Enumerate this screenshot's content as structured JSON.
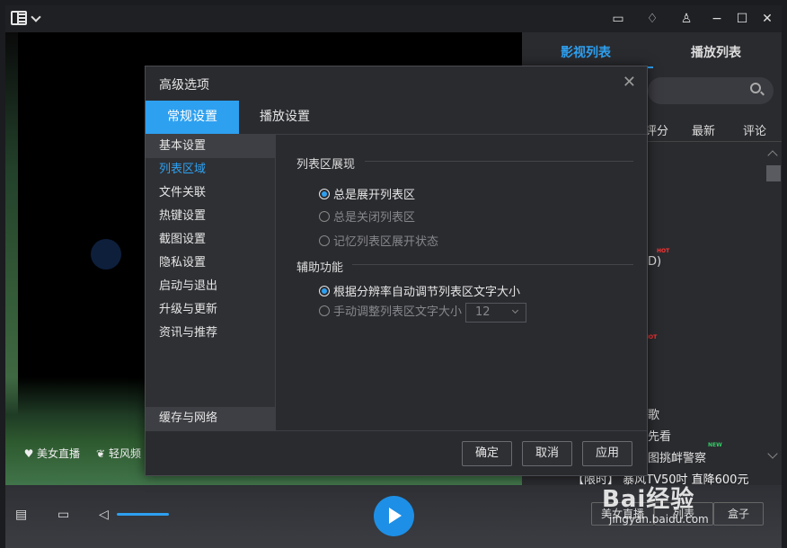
{
  "topbar": {
    "icons": [
      "menu-logo-icon",
      "chevron-down-icon",
      "feedback-icon",
      "notify-icon",
      "skin-icon",
      "minimize-icon",
      "maximize-icon",
      "close-icon"
    ]
  },
  "video": {
    "links": [
      "美女直播",
      "轻风频"
    ]
  },
  "right_panel": {
    "tabs": [
      "影视列表",
      "播放列表"
    ],
    "sort": [
      "评分",
      "最新",
      "评论"
    ],
    "list_fragments": [
      "D)",
      "歌",
      "先看",
      "图挑衅警察"
    ],
    "hot_badge": "HOT",
    "new_badge": "NEW",
    "promo": "【限时】 暴风TV50吋 直降600元"
  },
  "control_bar": {
    "buttons": [
      "美女直播",
      "列表",
      "盒子"
    ]
  },
  "watermark": {
    "logo": "Bai经验",
    "url": "jingyan.baidu.com"
  },
  "dialog": {
    "title": "高级选项",
    "tabs": [
      "常规设置",
      "播放设置"
    ],
    "sidebar": [
      "基本设置",
      "列表区域",
      "文件关联",
      "热键设置",
      "截图设置",
      "隐私设置",
      "启动与退出",
      "升级与更新",
      "资讯与推荐",
      "缓存与网络"
    ],
    "section1": {
      "title": "列表区展现",
      "options": [
        "总是展开列表区",
        "总是关闭列表区",
        "记忆列表区展开状态"
      ]
    },
    "section2": {
      "title": "辅助功能",
      "options": [
        "根据分辨率自动调节列表区文字大小",
        "手动调整列表区文字大小"
      ],
      "font_size": "12"
    },
    "footer": {
      "ok": "确定",
      "cancel": "取消",
      "apply": "应用"
    }
  },
  "colors": {
    "accent": "#2ea0f0"
  }
}
